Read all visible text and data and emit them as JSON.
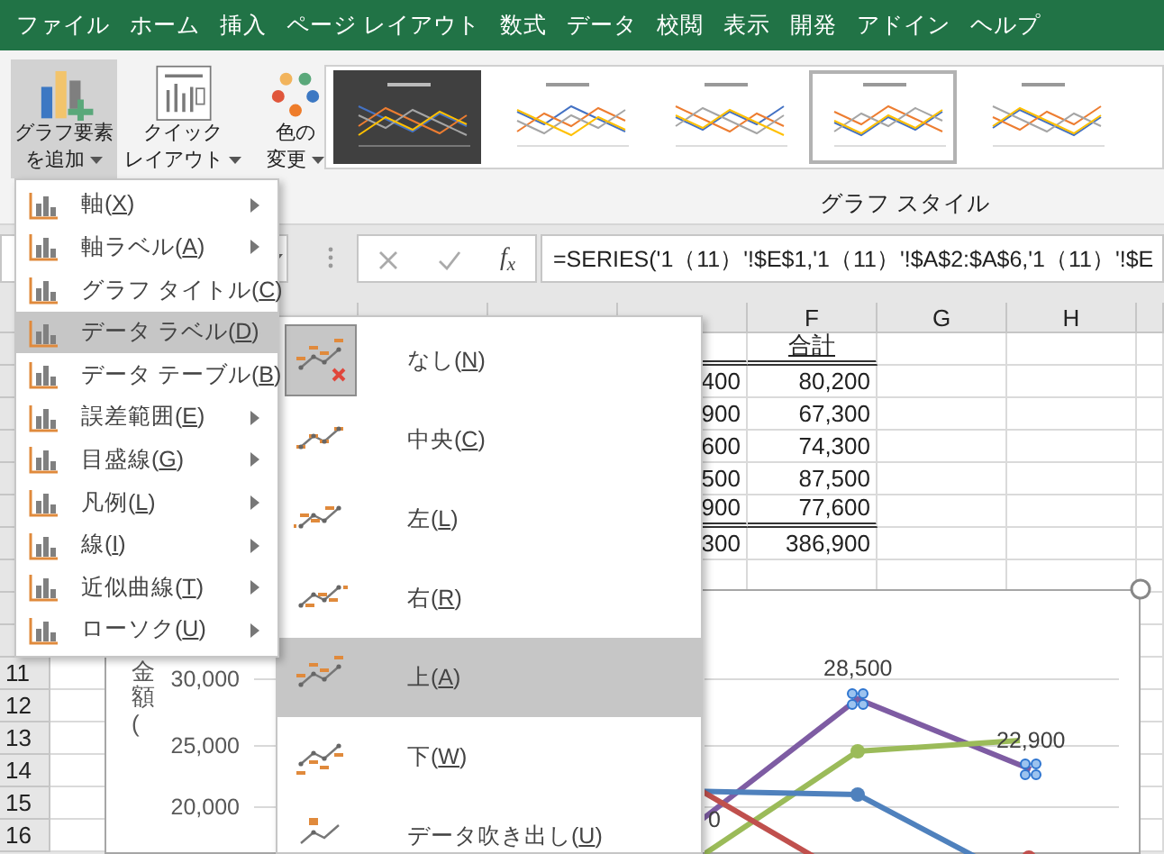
{
  "tabs": [
    {
      "label": "ファイル"
    },
    {
      "label": "ホーム"
    },
    {
      "label": "挿入"
    },
    {
      "label": "ページ レイアウト"
    },
    {
      "label": "数式"
    },
    {
      "label": "データ"
    },
    {
      "label": "校閲"
    },
    {
      "label": "表示"
    },
    {
      "label": "開発"
    },
    {
      "label": "アドイン"
    },
    {
      "label": "ヘルプ"
    }
  ],
  "ribbon": {
    "buttons": [
      {
        "lines": [
          "グラフ要素",
          "を追加"
        ],
        "kind": "add-element",
        "pressed": true
      },
      {
        "lines": [
          "クイック",
          "レイアウト"
        ],
        "kind": "quick-layout",
        "pressed": false
      },
      {
        "lines": [
          "色の",
          "変更"
        ],
        "kind": "colors",
        "pressed": false
      }
    ],
    "styles": [
      {
        "dark": true,
        "selected": false
      },
      {
        "dark": false,
        "selected": false
      },
      {
        "dark": false,
        "selected": false
      },
      {
        "dark": false,
        "selected": true
      },
      {
        "dark": false,
        "selected": false
      }
    ],
    "group_label": "グラフ スタイル"
  },
  "formula_bar": {
    "function_label": "f$_{x}$",
    "formula": "=SERIES('1（11）'!$E$1,'1（11）'!$A$2:$A$6,'1（11）'!$E"
  },
  "columns": [
    "F",
    "G",
    "H"
  ],
  "table": [
    {
      "total": "合計",
      "heading": true,
      "rule_below": true
    },
    {
      "partial": "400",
      "total": "80,200",
      "heading": false,
      "rule_below": false
    },
    {
      "partial": "900",
      "total": "67,300",
      "heading": false,
      "rule_below": false
    },
    {
      "partial": "600",
      "total": "74,300",
      "heading": false,
      "rule_below": false
    },
    {
      "partial": "500",
      "total": "87,500",
      "heading": false,
      "rule_below": false
    },
    {
      "partial": "900",
      "total": "77,600",
      "heading": false,
      "rule_below": true
    },
    {
      "partial": "300",
      "total": "386,900",
      "heading": false,
      "rule_below": false
    }
  ],
  "row_numbers": [
    "11",
    "12",
    "13",
    "14",
    "15",
    "16"
  ],
  "menu": {
    "items": [
      {
        "label": "軸(X)",
        "highlighted": false
      },
      {
        "label": "軸ラベル(A)",
        "highlighted": false
      },
      {
        "label": "グラフ タイトル(C)",
        "highlighted": false
      },
      {
        "label": "データ ラベル(D)",
        "highlighted": true
      },
      {
        "label": "データ テーブル(B)",
        "highlighted": false
      },
      {
        "label": "誤差範囲(E)",
        "highlighted": false
      },
      {
        "label": "目盛線(G)",
        "highlighted": false
      },
      {
        "label": "凡例(L)",
        "highlighted": false
      },
      {
        "label": "線(I)",
        "highlighted": false
      },
      {
        "label": "近似曲線(T)",
        "highlighted": false
      },
      {
        "label": "ローソク(U)",
        "highlighted": false
      }
    ]
  },
  "submenu": {
    "items": [
      {
        "label": "なし(N)",
        "kind": "none",
        "selected": true,
        "highlighted": false
      },
      {
        "label": "中央(C)",
        "kind": "center",
        "selected": false,
        "highlighted": false
      },
      {
        "label": "左(L)",
        "kind": "left",
        "selected": false,
        "highlighted": false
      },
      {
        "label": "右(R)",
        "kind": "right",
        "selected": false,
        "highlighted": false
      },
      {
        "label": "上(A)",
        "kind": "above",
        "selected": false,
        "highlighted": true
      },
      {
        "label": "下(W)",
        "kind": "below",
        "selected": false,
        "highlighted": false
      },
      {
        "label": "データ吹き出し(U)",
        "kind": "callout",
        "selected": false,
        "highlighted": false
      }
    ]
  },
  "chart": {
    "axis_title": "金額(",
    "y_labels": [
      "30,000",
      "25,000",
      "20,000"
    ],
    "data_labels": [
      "0",
      "28,500",
      "22,900"
    ]
  }
}
